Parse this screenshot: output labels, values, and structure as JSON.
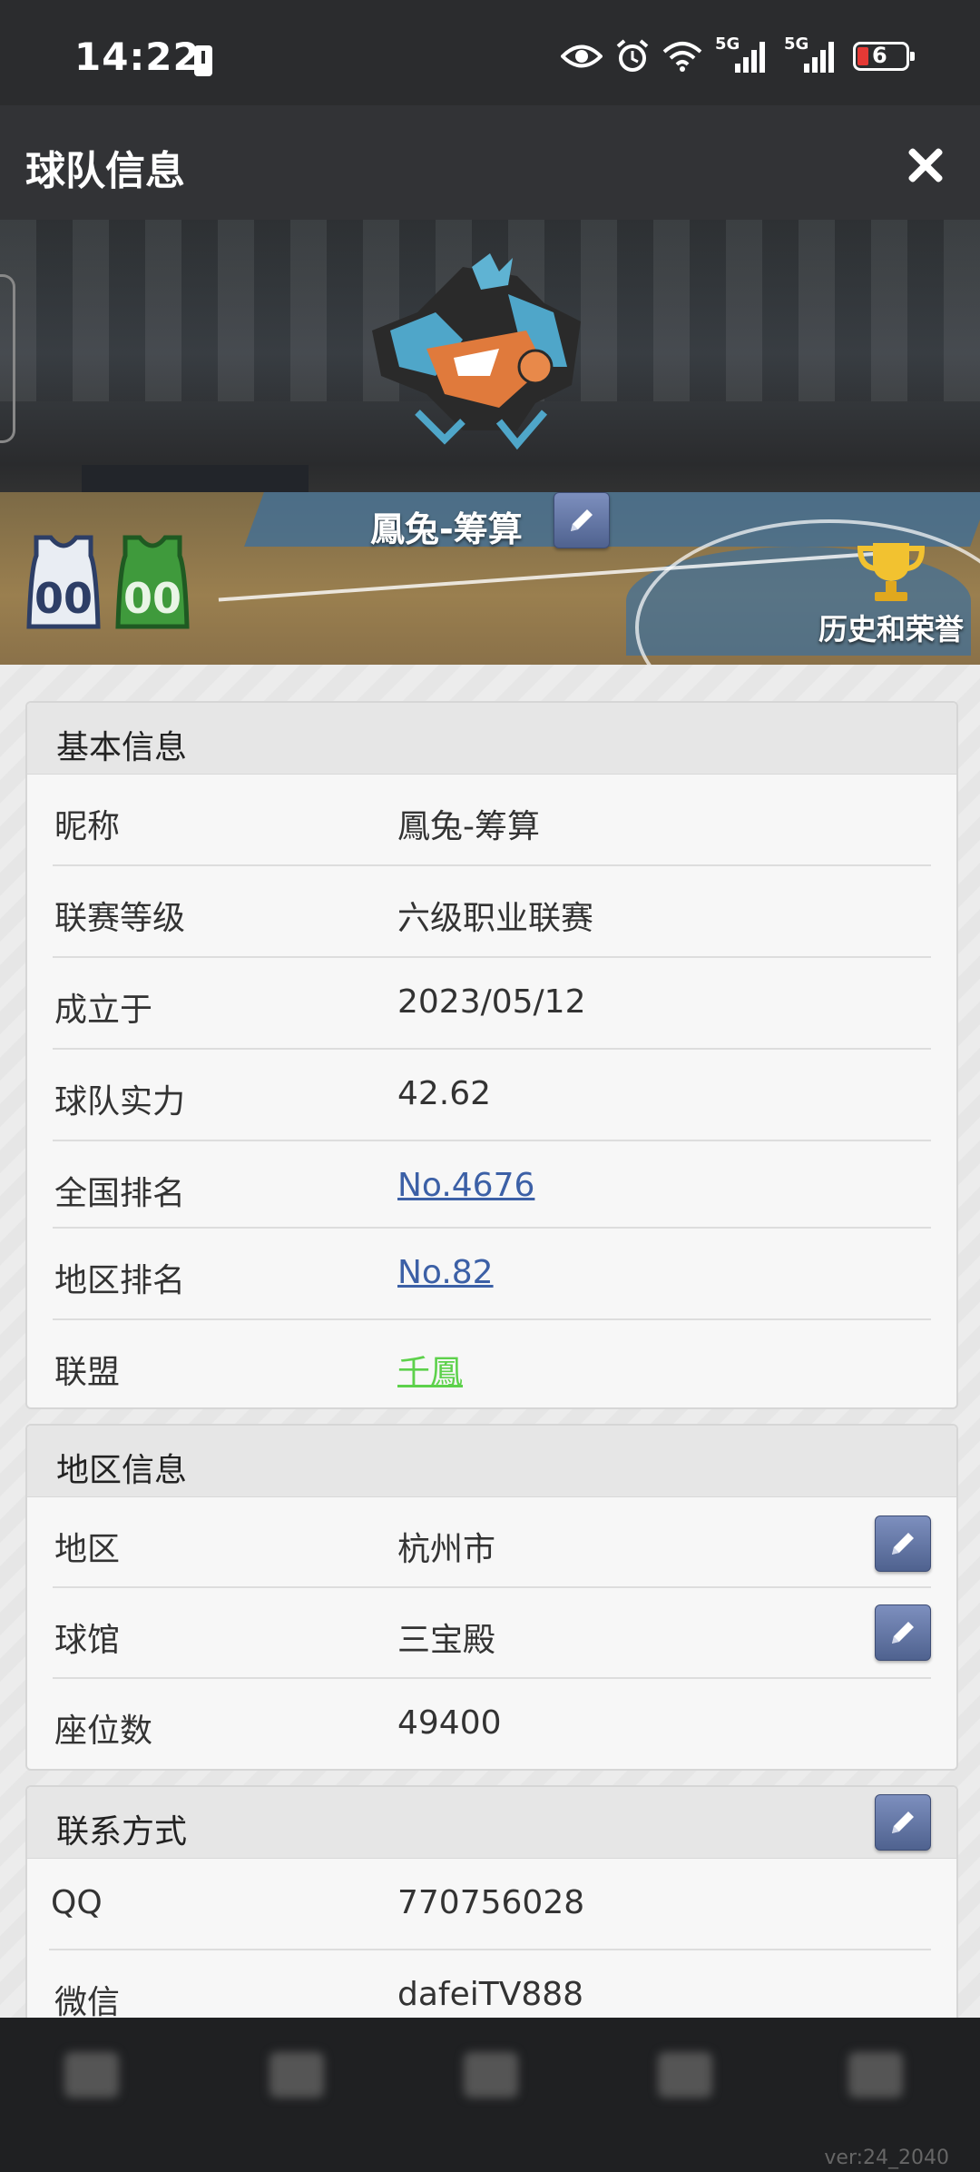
{
  "status_bar": {
    "time": "14:22",
    "signal_1": "5G",
    "signal_2": "5G",
    "battery": "6",
    "icons": [
      "alert-icon",
      "eye-icon",
      "alarm-icon",
      "wifi-icon",
      "signal-icon",
      "signal-icon",
      "battery-icon"
    ]
  },
  "header": {
    "title": "球队信息",
    "close_icon": "close-icon"
  },
  "hero": {
    "team_name": "鳳兔-筹算",
    "home_jersey_number": "00",
    "away_jersey_number": "00",
    "honor_label": "历史和荣誉",
    "colors": {
      "home_jersey": "#e9edf3",
      "away_jersey": "#3f9a3c",
      "edit_button": "#5d6f9c"
    }
  },
  "basic_info": {
    "title": "基本信息",
    "rows": [
      {
        "label": "昵称",
        "value": "鳳兔-筹算"
      },
      {
        "label": "联赛等级",
        "value": "六级职业联赛"
      },
      {
        "label": "成立于",
        "value": "2023/05/12"
      },
      {
        "label": "球队实力",
        "value": "42.62"
      },
      {
        "label": "全国排名",
        "value": "No.4676"
      },
      {
        "label": "地区排名",
        "value": "No.82"
      },
      {
        "label": "联盟",
        "value": "千鳳"
      }
    ]
  },
  "region_info": {
    "title": "地区信息",
    "rows": [
      {
        "label": "地区",
        "value": "杭州市"
      },
      {
        "label": "球馆",
        "value": "三宝殿"
      },
      {
        "label": "座位数",
        "value": "49400"
      }
    ]
  },
  "contact": {
    "title": "联系方式",
    "rows": [
      {
        "label": "QQ",
        "value": "770756028"
      },
      {
        "label": "微信",
        "value": "dafeiTV888"
      }
    ]
  },
  "footer": {
    "version": "ver:24_2040"
  }
}
